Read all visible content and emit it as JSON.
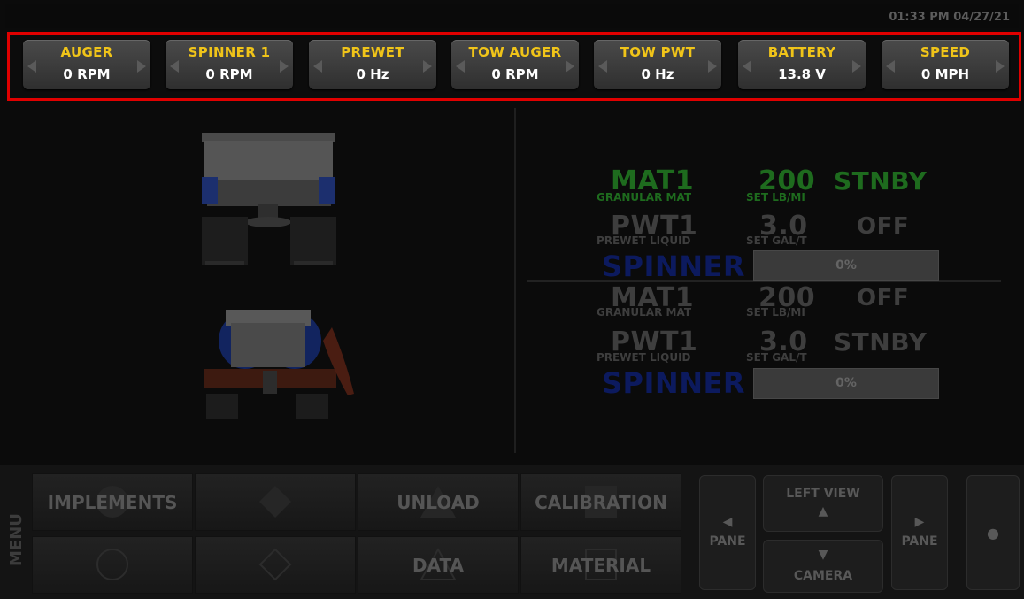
{
  "status": {
    "clock": "01:33 PM 04/27/21"
  },
  "gauges": [
    {
      "label": "AUGER",
      "value": "0 RPM"
    },
    {
      "label": "SPINNER 1",
      "value": "0 RPM"
    },
    {
      "label": "PREWET",
      "value": "0 Hz"
    },
    {
      "label": "TOW AUGER",
      "value": "0 RPM"
    },
    {
      "label": "TOW PWT",
      "value": "0 Hz"
    },
    {
      "label": "BATTERY",
      "value": "13.8 V"
    },
    {
      "label": "SPEED",
      "value": "0 MPH"
    }
  ],
  "panel_top": {
    "mat": {
      "name": "MAT1",
      "sub": "GRANULAR MAT",
      "rate": "200",
      "unit": "SET LB/MI",
      "state": "STNBY"
    },
    "pwt": {
      "name": "PWT1",
      "sub": "PREWET LIQUID",
      "rate": "3.0",
      "unit": "SET GAL/T",
      "state": "OFF"
    },
    "spinner": {
      "name": "SPINNER",
      "pct": "0%",
      "level": 0
    }
  },
  "panel_bottom": {
    "mat": {
      "name": "MAT1",
      "sub": "GRANULAR MAT",
      "rate": "200",
      "unit": "SET LB/MI",
      "state": "OFF"
    },
    "pwt": {
      "name": "PWT1",
      "sub": "PREWET LIQUID",
      "rate": "3.0",
      "unit": "SET GAL/T",
      "state": "STNBY"
    },
    "spinner": {
      "name": "SPINNER",
      "pct": "0%",
      "level": 0
    }
  },
  "menu": {
    "label": "MENU",
    "buttons": [
      "IMPLEMENTS",
      "UNLOAD",
      "CALIBRATION",
      "DATA",
      "MATERIAL"
    ]
  },
  "nav": {
    "pane_left": "PANE",
    "pane_right": "PANE",
    "left_view": "LEFT VIEW",
    "camera": "CAMERA"
  },
  "colors": {
    "gauge_label": "#f0c419",
    "alert_border": "#e00000",
    "active_green": "#1e6b1e",
    "spinner_blue": "#0c1a5e",
    "dim_gray": "#3e3e3e"
  }
}
